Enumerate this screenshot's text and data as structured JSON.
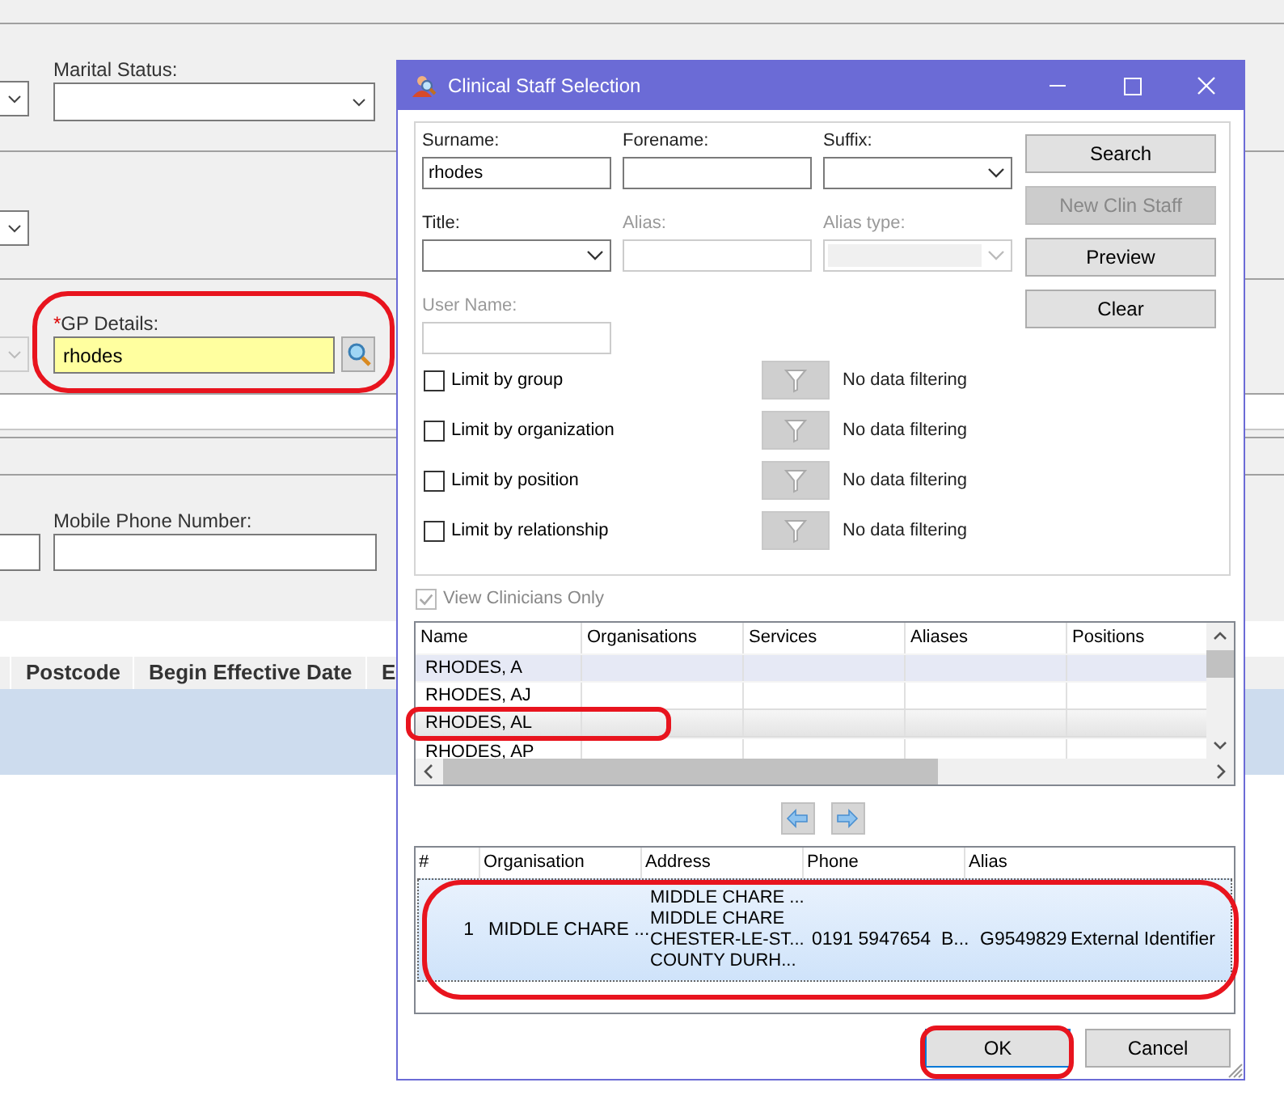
{
  "background_form": {
    "marital_status": {
      "label": "Marital Status:"
    },
    "gp_details": {
      "required_mark": "*",
      "label": "GP Details:",
      "value": "rhodes"
    },
    "mobile_phone": {
      "label": "Mobile Phone Number:"
    },
    "table": {
      "columns": [
        "Postcode",
        "Begin Effective Date",
        "E"
      ],
      "rows": [
        {
          "selected": true
        }
      ]
    }
  },
  "dialog": {
    "title": "Clinical Staff Selection",
    "fields": [
      {
        "label": "Surname:",
        "kind": "text",
        "value": "rhodes",
        "disabled": false
      },
      {
        "label": "Forename:",
        "kind": "text",
        "disabled": false
      },
      {
        "label": "Suffix:",
        "kind": "dropdown",
        "disabled": false
      },
      {
        "label": "Title:",
        "kind": "dropdown",
        "disabled": false
      },
      {
        "label": "Alias:",
        "kind": "text",
        "disabled": true
      },
      {
        "label": "Alias type:",
        "kind": "dropdown",
        "disabled": true
      },
      {
        "label": "User Name:",
        "kind": "text",
        "disabled": true
      }
    ],
    "buttons": [
      {
        "label": "Search",
        "disabled": false
      },
      {
        "label": "New Clin Staff",
        "disabled": true
      },
      {
        "label": "Preview",
        "disabled": false
      },
      {
        "label": "Clear",
        "disabled": false
      }
    ],
    "limits": [
      {
        "label": "Limit by group",
        "checked": false,
        "filter_status": "No data filtering"
      },
      {
        "label": "Limit by organization",
        "checked": false,
        "filter_status": "No data filtering"
      },
      {
        "label": "Limit by position",
        "checked": false,
        "filter_status": "No data filtering"
      },
      {
        "label": "Limit by relationship",
        "checked": false,
        "filter_status": "No data filtering"
      }
    ],
    "view_clinicians_only": {
      "label": "View Clinicians Only",
      "checked": true,
      "disabled": true
    },
    "results": {
      "columns": [
        "Name",
        "Organisations",
        "Services",
        "Aliases",
        "Positions"
      ],
      "rows": [
        {
          "name": "RHODES, A",
          "selected": false,
          "hovered": true
        },
        {
          "name": "RHODES, AJ",
          "selected": false,
          "hovered": false
        },
        {
          "name": "RHODES, AL",
          "selected": true,
          "hovered": false
        },
        {
          "name": "RHODES, AP",
          "selected": false,
          "hovered": false
        }
      ]
    },
    "detail": {
      "columns": [
        "#",
        "Organisation",
        "Address",
        "Phone",
        "Alias"
      ],
      "rows": [
        {
          "number": "1",
          "organisation": "MIDDLE CHARE ...",
          "address": [
            "MIDDLE CHARE ...",
            "MIDDLE CHARE",
            "CHESTER-LE-ST...",
            "COUNTY DURH..."
          ],
          "phone": "0191 5947654",
          "column_5": "B...",
          "alias": "G9549829",
          "column_7": "External Identifier",
          "selected": true
        }
      ]
    },
    "footer_buttons": [
      {
        "label": "OK",
        "default": true
      },
      {
        "label": "Cancel",
        "default": false
      }
    ]
  }
}
